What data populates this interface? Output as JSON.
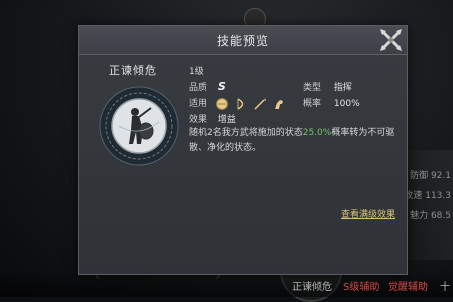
{
  "background": {
    "stats": [
      "防御 92.1",
      "攻速 113.3",
      "魅力 68.5"
    ],
    "bottom_labels": [
      {
        "text": "正谏倾危",
        "color": "#bcbcbc"
      },
      {
        "text": "S级辅助",
        "color": "#d84a4a"
      },
      {
        "text": "觉醒辅助",
        "color": "#d84a4a"
      },
      {
        "text": "十",
        "color": "#bcbcbc"
      }
    ]
  },
  "dialog": {
    "title": "技能预览",
    "close_icon": "crossed-blades-close-icon",
    "skill_name": "正谏倾危",
    "level": "1级",
    "grade_label": "品质",
    "grade_value": "S",
    "type_label": "类型",
    "type_value": "指挥",
    "applicable_label": "适用",
    "applicable_icons": [
      "shield-icon",
      "bow-icon",
      "spear-icon",
      "horse-icon"
    ],
    "rate_label": "概率",
    "rate_value": "100%",
    "effect_label": "效果",
    "effect_value": "增益",
    "description_prefix": "随机2名我方武将施加的状态",
    "description_highlight": "25.0%",
    "description_suffix": "概率转为不可驱散、净化的状态。",
    "max_level_link": "查看满级效果"
  },
  "colors": {
    "highlight": "#6fc36a",
    "link": "#d9c27a"
  }
}
